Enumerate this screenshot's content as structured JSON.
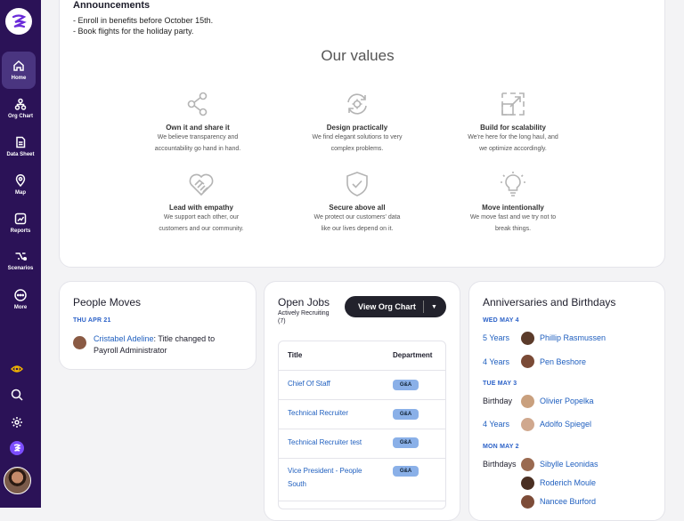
{
  "sidebar": {
    "items": [
      {
        "label": "Home",
        "icon": "home-icon"
      },
      {
        "label": "Org Chart",
        "icon": "org-chart-icon"
      },
      {
        "label": "Data Sheet",
        "icon": "document-icon"
      },
      {
        "label": "Map",
        "icon": "map-pin-icon"
      },
      {
        "label": "Reports",
        "icon": "chart-icon"
      },
      {
        "label": "Scenarios",
        "icon": "scenarios-icon"
      },
      {
        "label": "More",
        "icon": "more-icon"
      }
    ],
    "accent": "#f2b400",
    "background": "#2b1257"
  },
  "announcements": {
    "title": "Announcements",
    "lines": [
      "- Enroll in benefits before October 15th.",
      "- Book flights for the holiday party."
    ]
  },
  "values": {
    "title": "Our values",
    "items": [
      {
        "title": "Own it and share it",
        "line1": "We believe transparency and",
        "line2": "accountability go hand in hand.",
        "icon": "share-icon"
      },
      {
        "title": "Design practically",
        "line1": "We find elegant solutions to very",
        "line2": "complex problems.",
        "icon": "gear-cycle-icon"
      },
      {
        "title": "Build for scalability",
        "line1": "We're here for the long haul, and",
        "line2": "we optimize accordingly.",
        "icon": "scale-icon"
      },
      {
        "title": "Lead with empathy",
        "line1": "We support each other, our",
        "line2": "customers and our community.",
        "icon": "heart-handshake-icon"
      },
      {
        "title": "Secure above all",
        "line1": "We protect our customers' data",
        "line2": "like our lives depend on it.",
        "icon": "shield-icon"
      },
      {
        "title": "Move intentionally",
        "line1": "We move fast and we try not to",
        "line2": "break things.",
        "icon": "lightbulb-icon"
      }
    ]
  },
  "people_moves": {
    "title": "People Moves",
    "date": "THU APR 21",
    "name": "Cristabel Adeline",
    "change_line1": ": Title changed to",
    "change_line2": "Payroll Administrator"
  },
  "open_jobs": {
    "title": "Open Jobs",
    "subtitle_line1": "Actively Recruiting",
    "subtitle_line2": "(7)",
    "button_label": "View Org Chart",
    "columns": [
      "Title",
      "Department"
    ],
    "rows": [
      {
        "title": "Chief Of Staff",
        "dept": "G&A"
      },
      {
        "title": "Technical Recruiter",
        "dept": "G&A"
      },
      {
        "title": "Technical Recruiter test",
        "dept": "G&A"
      },
      {
        "title_line1": "Vice President - People",
        "title_line2": "South",
        "dept": "G&A"
      }
    ]
  },
  "anniversaries": {
    "title": "Anniversaries and Birthdays",
    "dates": [
      "WED MAY 4",
      "TUE MAY 3",
      "MON MAY 2"
    ],
    "entries": [
      {
        "kind": "5 Years",
        "name": "Phillip Rasmussen"
      },
      {
        "kind": "4 Years",
        "name": "Pen Beshore"
      },
      {
        "kind": "Birthday",
        "name": "Olivier Popelka"
      },
      {
        "kind": "4 Years",
        "name": "Adolfo Spiegel"
      },
      {
        "kind": "Birthdays",
        "name": "Sibylle Leonidas"
      },
      {
        "kind": "",
        "name": "Roderich Moule"
      },
      {
        "kind": "",
        "name": "Nancee Burford"
      }
    ]
  }
}
